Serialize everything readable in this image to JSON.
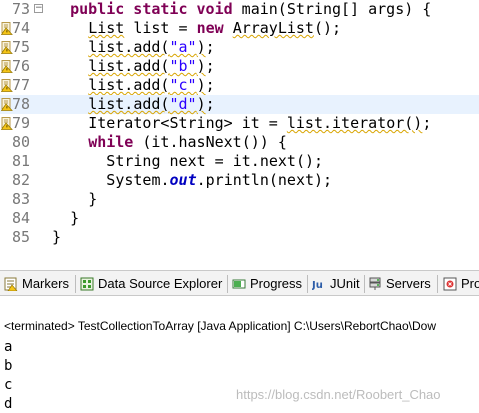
{
  "editor": {
    "lines": [
      {
        "num": "73",
        "fold": "−",
        "warn": false,
        "indent": 2,
        "highlight": false,
        "tokens": [
          {
            "t": "public static void",
            "c": "kw"
          },
          {
            "t": " main(String[] args) {"
          }
        ]
      },
      {
        "num": "74",
        "warn": true,
        "indent": 4,
        "highlight": false,
        "tokens": [
          {
            "t": "List",
            "c": "warnu"
          },
          {
            "t": " list = "
          },
          {
            "t": "new",
            "c": "kw"
          },
          {
            "t": " "
          },
          {
            "t": "ArrayList",
            "c": "warnu"
          },
          {
            "t": "();"
          }
        ]
      },
      {
        "num": "75",
        "warn": true,
        "indent": 4,
        "highlight": false,
        "tokens": [
          {
            "t": "list.add(",
            "c": "warnu"
          },
          {
            "t": "\"a\"",
            "c": "str warnu"
          },
          {
            "t": ")",
            "c": "warnu"
          },
          {
            "t": ";"
          }
        ]
      },
      {
        "num": "76",
        "warn": true,
        "indent": 4,
        "highlight": false,
        "tokens": [
          {
            "t": "list.add(",
            "c": "warnu"
          },
          {
            "t": "\"b\"",
            "c": "str warnu"
          },
          {
            "t": ")",
            "c": "warnu"
          },
          {
            "t": ";"
          }
        ]
      },
      {
        "num": "77",
        "warn": true,
        "indent": 4,
        "highlight": false,
        "tokens": [
          {
            "t": "list.add(",
            "c": "warnu"
          },
          {
            "t": "\"c\"",
            "c": "str warnu"
          },
          {
            "t": ")",
            "c": "warnu"
          },
          {
            "t": ";"
          }
        ]
      },
      {
        "num": "78",
        "warn": true,
        "indent": 4,
        "highlight": true,
        "tokens": [
          {
            "t": "list.add(",
            "c": "warnu"
          },
          {
            "t": "\"d\"",
            "c": "str warnu"
          },
          {
            "t": ")",
            "c": "warnu"
          },
          {
            "t": ";"
          }
        ]
      },
      {
        "num": "79",
        "warn": true,
        "indent": 4,
        "highlight": false,
        "tokens": [
          {
            "t": "Iterator<String> it = "
          },
          {
            "t": "list.iterator()",
            "c": "warnu"
          },
          {
            "t": ";"
          }
        ]
      },
      {
        "num": "80",
        "warn": false,
        "indent": 4,
        "highlight": false,
        "tokens": [
          {
            "t": "while",
            "c": "kw"
          },
          {
            "t": " (it.hasNext()) {"
          }
        ]
      },
      {
        "num": "81",
        "warn": false,
        "indent": 6,
        "highlight": false,
        "tokens": [
          {
            "t": "String next = it.next();"
          }
        ]
      },
      {
        "num": "82",
        "warn": false,
        "indent": 6,
        "highlight": false,
        "tokens": [
          {
            "t": "System."
          },
          {
            "t": "out",
            "c": "fld"
          },
          {
            "t": ".println(next);"
          }
        ]
      },
      {
        "num": "83",
        "warn": false,
        "indent": 4,
        "highlight": false,
        "tokens": [
          {
            "t": "}"
          }
        ]
      },
      {
        "num": "84",
        "warn": false,
        "indent": 2,
        "highlight": false,
        "tokens": [
          {
            "t": "}"
          }
        ]
      },
      {
        "num": "85",
        "warn": false,
        "indent": 0,
        "highlight": false,
        "tokens": [
          {
            "t": "}"
          }
        ]
      }
    ]
  },
  "tabs": [
    {
      "label": "Markers",
      "icon": "markers-icon"
    },
    {
      "label": "Data Source Explorer",
      "icon": "data-source-explorer-icon"
    },
    {
      "label": "Progress",
      "icon": "progress-icon"
    },
    {
      "label": "JUnit",
      "icon": "junit-icon"
    },
    {
      "label": "Servers",
      "icon": "servers-icon"
    },
    {
      "label": "Pro",
      "icon": "problems-icon"
    }
  ],
  "console": {
    "terminated": "<terminated> TestCollectionToArray [Java Application] C:\\Users\\RebortChao\\Dow",
    "output": [
      "a",
      "b",
      "c",
      "d"
    ],
    "watermark": "https://blog.csdn.net/Roobert_Chao"
  },
  "colors": {
    "keyword": "#7f0055",
    "string": "#2a00ff",
    "static_field": "#0000c0",
    "line_highlight": "#e8f2fe",
    "warning_underline": "#d8a400"
  }
}
